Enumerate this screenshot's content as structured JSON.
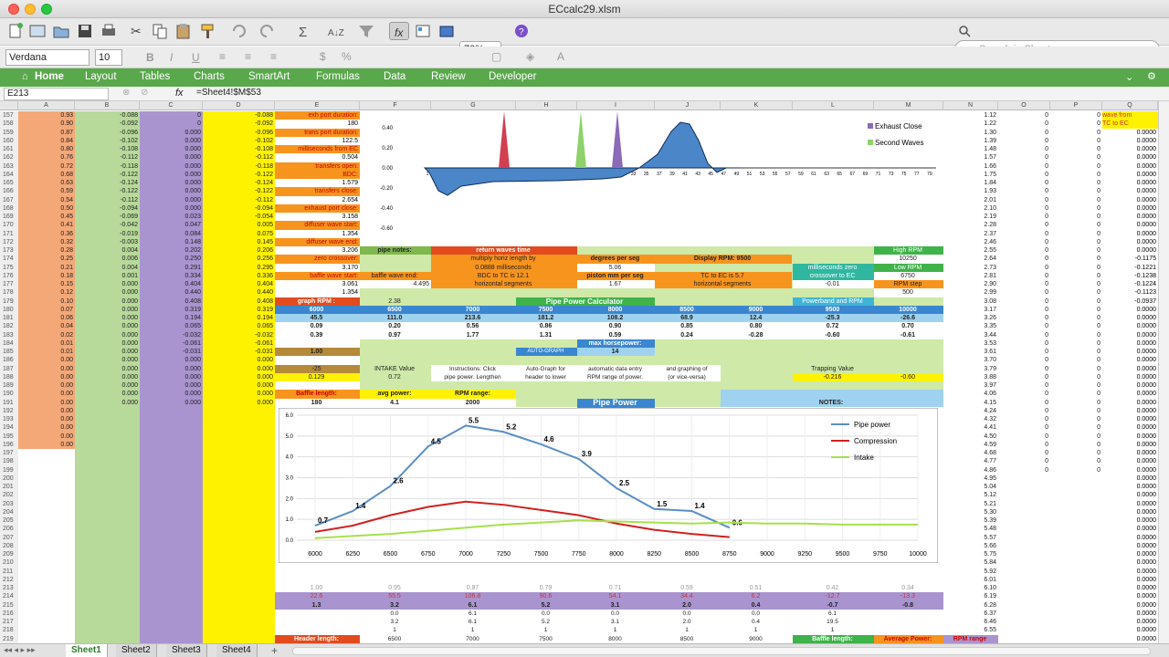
{
  "window": {
    "title": "ECcalc29.xlsm"
  },
  "toolbar": {
    "zoom": "70%",
    "search_placeholder": "Search in Sheet"
  },
  "fontbar": {
    "font_name": "Verdana",
    "font_size": "10"
  },
  "ribbon": {
    "tabs": [
      "Home",
      "Layout",
      "Tables",
      "Charts",
      "SmartArt",
      "Formulas",
      "Data",
      "Review",
      "Developer"
    ]
  },
  "formula_bar": {
    "cell_ref": "E213",
    "fx": "fx",
    "formula": "=Sheet4!$M$53"
  },
  "columns": [
    "A",
    "B",
    "C",
    "D",
    "E",
    "F",
    "G",
    "H",
    "I",
    "J",
    "K",
    "L",
    "M",
    "N",
    "O",
    "P",
    "Q"
  ],
  "rows": [
    "157",
    "158",
    "159",
    "160",
    "161",
    "162",
    "163",
    "164",
    "165",
    "166",
    "167",
    "168",
    "169",
    "170",
    "171",
    "172",
    "173",
    "174",
    "175",
    "176",
    "177",
    "178",
    "179",
    "180",
    "181",
    "182",
    "183",
    "184",
    "185",
    "186",
    "187",
    "188",
    "189",
    "190",
    "191",
    "192",
    "193",
    "194",
    "195",
    "196",
    "197",
    "198",
    "199",
    "200",
    "201",
    "202",
    "203",
    "204",
    "205",
    "206",
    "207",
    "208",
    "209",
    "210",
    "211",
    "212",
    "213",
    "214",
    "215",
    "216",
    "217",
    "218",
    "219",
    "220",
    "221"
  ],
  "col_a": [
    "0.93",
    "0.90",
    "0.87",
    "0.84",
    "0.80",
    "0.76",
    "0.72",
    "0.68",
    "0.63",
    "0.59",
    "0.54",
    "0.50",
    "0.45",
    "0.41",
    "0.36",
    "0.32",
    "0.28",
    "0.25",
    "0.21",
    "0.18",
    "0.15",
    "0.12",
    "0.10",
    "0.07",
    "0.06",
    "0.04",
    "0.02",
    "0.01",
    "0.01",
    "0.00",
    "0.00",
    "0.00",
    "0.00",
    "0.00",
    "0.00",
    "0.00",
    "0.00",
    "0.00",
    "0.00",
    "0.00"
  ],
  "col_b": [
    "-0.088",
    "-0.092",
    "-0.096",
    "-0.102",
    "-0.108",
    "-0.112",
    "-0.118",
    "-0.122",
    "-0.124",
    "-0.122",
    "-0.112",
    "-0.094",
    "-0.069",
    "-0.042",
    "-0.019",
    "-0.003",
    "0.004",
    "0.006",
    "0.004",
    "0.001",
    "0.000",
    "0.000",
    "0.000",
    "0.000",
    "0.000",
    "0.000",
    "0.000",
    "0.000",
    "0.000",
    "0.000",
    "0.000",
    "0.000",
    "0.000",
    "0.000",
    "0.000"
  ],
  "col_c": [
    "0",
    "0",
    "0.000",
    "0.000",
    "0.000",
    "0.000",
    "0.000",
    "0.000",
    "0.000",
    "0.000",
    "0.000",
    "0.000",
    "0.023",
    "0.047",
    "0.084",
    "0.148",
    "0.202",
    "0.250",
    "0.291",
    "0.334",
    "0.404",
    "0.440",
    "0.408",
    "0.319",
    "0.194",
    "0.065",
    "-0.032",
    "-0.061",
    "-0.031",
    "0.000",
    "0.000",
    "0.000",
    "0.000",
    "0.000",
    "0.000"
  ],
  "col_d": [
    "-0.088",
    "-0.092",
    "-0.096",
    "-0.102",
    "-0.108",
    "-0.112",
    "-0.118",
    "-0.122",
    "-0.124",
    "-0.122",
    "-0.112",
    "-0.094",
    "-0.054",
    "0.005",
    "0.075",
    "0.145",
    "0.206",
    "0.256",
    "0.295",
    "0.336",
    "0.404",
    "0.440",
    "0.408",
    "0.319",
    "0.194",
    "0.065",
    "-0.032",
    "-0.061",
    "-0.031",
    "0.000",
    "0.000",
    "0.000",
    "0.000",
    "0.000",
    "0.000"
  ],
  "col_e_labels": [
    "exh port duration:",
    "180",
    "trans port duration:",
    "122.5",
    "milliseconds from EC",
    "0.504",
    "transfers open:",
    "BDC:",
    "1.579",
    "transfers close:",
    "2.654",
    "exhaust port close:",
    "3.158",
    "diffuser wave start:",
    "1.354",
    "diffuser wave end:",
    "3.206",
    "zero crossover:",
    "3.170",
    "baffle wave start:",
    "3.061",
    "1.354"
  ],
  "col_n": [
    "1.12",
    "1.22",
    "1.30",
    "1.39",
    "1.48",
    "1.57",
    "1.66",
    "1.75",
    "1.84",
    "1.93",
    "2.01",
    "2.10",
    "2.19",
    "2.28",
    "2.37",
    "2.46",
    "2.55",
    "2.64",
    "2.73",
    "2.81",
    "2.90",
    "2.99",
    "3.08",
    "3.17",
    "3.26",
    "3.35",
    "3.44",
    "3.53",
    "3.61",
    "3.70",
    "3.79",
    "3.88",
    "3.97",
    "4.06",
    "4.15",
    "4.24",
    "4.32",
    "4.41",
    "4.50",
    "4.59",
    "4.68",
    "4.77",
    "4.86",
    "4.95",
    "5.04",
    "5.12",
    "5.21",
    "5.30",
    "5.39",
    "5.48",
    "5.57",
    "5.66",
    "5.75",
    "5.84",
    "5.92",
    "6.01",
    "6.10",
    "6.19",
    "6.28",
    "6.37",
    "6.46",
    "6.55",
    "6.63"
  ],
  "col_q": [
    "wave from",
    "TC to EC",
    "0.0000",
    "0.0000",
    "0.0000",
    "0.0000",
    "0.0000",
    "0.0000",
    "0.0000",
    "0.0000",
    "0.0000",
    "0.0000",
    "0.0000",
    "0.0000",
    "0.0000",
    "0.0000",
    "0.0000",
    "-0.1175",
    "-0.1221",
    "-0.1238",
    "-0.1224",
    "-0.1123",
    "-0.0937",
    "0.0000",
    "0.0000",
    "0.0000",
    "0.0000",
    "0.0000",
    "0.0000",
    "0.0000",
    "0.0000",
    "0.0000",
    "0.0000",
    "0.0000",
    "0.0000",
    "0.0000",
    "0.0000",
    "0.0000",
    "0.0000",
    "0.0000",
    "0.0000",
    "0.0000",
    "0.0000",
    "0.0000",
    "0.0000",
    "0.0000",
    "0.0000",
    "0.0000",
    "0.0000",
    "0.0000",
    "0.0000",
    "0.0000",
    "0.0000",
    "0.0000",
    "0.0000",
    "0.0000",
    "0.0000",
    "0.0000",
    "0.0000",
    "0.0000",
    "0.0000",
    "0.0000",
    "0.0000"
  ],
  "panel": {
    "pipe_notes": "pipe notes:",
    "return_waves_time": "return waves time",
    "multiply_horiz": "multiply horiz length by",
    "ms_value": "0.0888",
    "ms_label": "milliseconds",
    "bdc_to_tc": "BDC to TC is",
    "bdc_to_tc_val": "12.1",
    "horiz_segments": "horizontal segments",
    "degrees_per_seg": "degrees per seg",
    "degrees_per_seg_val": "5.06",
    "piston_mm": "piston mm per seg",
    "piston_mm_val": "1.67",
    "tc_to_ec": "TC to EC is",
    "tc_to_ec_val": "5.7",
    "display_rpm": "Display RPM:",
    "display_rpm_val": "9500",
    "high_rpm": "High RPM",
    "high_rpm_val": "10250",
    "low_rpm": "Low RPM",
    "low_rpm_val": "6750",
    "rpm_step": "RPM step",
    "rpm_step_val": "500",
    "ms_zero": "milliseconds zero",
    "crossover_ec": "crossover to EC",
    "crossover_val": "-0.01",
    "baffle_wave_end": "baffle wave end:",
    "baffle_wave_end_val": "4.495",
    "graph_rpm": "graph RPM :",
    "graph_rpm_val": "2.38",
    "pipe_power_calc": "Pipe Power    Calculator",
    "powerband_rpm": "Powerband and RPM",
    "rpm_headers": [
      "6000",
      "6500",
      "7000",
      "7500",
      "8000",
      "8500",
      "9000",
      "9500",
      "10000"
    ],
    "row181": [
      "45.5",
      "111.0",
      "213.6",
      "181.2",
      "108.2",
      "68.9",
      "12.4",
      "-25.3",
      "-26.6"
    ],
    "row182": [
      "0.09",
      "0.20",
      "0.56",
      "0.86",
      "0.90",
      "0.85",
      "0.80",
      "0.72",
      "0.70"
    ],
    "row183": [
      "0.39",
      "0.97",
      "1.77",
      "1.31",
      "0.59",
      "0.24",
      "-0.28",
      "-0.60",
      "-0.61"
    ],
    "val_100": "1.00",
    "auto_graph": "AUTO-GRAPH",
    "max_hp": "max horsepower:",
    "max_hp_val": "14",
    "intake_value": "INTAKE Value",
    "intake_val": "-25",
    "intake_val2": "0.129",
    "intake_val3": "0.72",
    "instructions1": "Instructions: Click",
    "instructions2": "pipe power. Lengthen",
    "autograph1": "Auto-Graph for",
    "autograph2": "header to lower",
    "auto_data1": "automatic data entry",
    "auto_data2": "RPM range of power.",
    "graphing1": "and graphing of",
    "graphing2": "(or vice-versa)",
    "trapping_value": "Trapping Value",
    "trapping_val": "-0.216",
    "trapping_val2": "-0.60",
    "baffle_length": "Baffle length:",
    "baffle_length_val": "180",
    "avg_power": "avg power:",
    "avg_power_val": "4.1",
    "rpm_range": "RPM range:",
    "rpm_range_val": "2000",
    "pipe_power_btn": "Pipe Power",
    "notes": "NOTES:",
    "row213": [
      "1.00",
      "0.95",
      "0.87",
      "0.79",
      "0.71",
      "0.59",
      "0.51",
      "0.42",
      "0.34"
    ],
    "row214": [
      "22.6",
      "55.5",
      "106.8",
      "90.6",
      "54.1",
      "34.4",
      "6.2",
      "-12.7",
      "-13.3"
    ],
    "row215": [
      "1.3",
      "3.2",
      "6.1",
      "5.2",
      "3.1",
      "2.0",
      "0.4",
      "-0.7",
      "-0.8"
    ],
    "row216": [
      "0.0",
      "6.1",
      "0.0",
      "0.0",
      "0.0",
      "0.0",
      "6.1"
    ],
    "row217": [
      "3.2",
      "6.1",
      "5.2",
      "3.1",
      "2.0",
      "0.4",
      "19.5"
    ],
    "row218": [
      "1",
      "1",
      "1",
      "1",
      "1",
      "1",
      "1"
    ],
    "header_length": "Header length:",
    "bottom_rpms": [
      "6500",
      "7000",
      "7500",
      "8000",
      "8500",
      "9000"
    ],
    "baffle_length_bottom": "Baffle length:",
    "average_power": "Average Power:",
    "rpm_range_bottom": "RPM range"
  },
  "chart_data": [
    {
      "type": "area",
      "series": [
        {
          "name": "Exhaust Close",
          "color": "#8b6ab8"
        },
        {
          "name": "Second Waves",
          "color": "#8fd16c"
        }
      ],
      "x": [
        "1",
        "3",
        "5",
        "7",
        "9",
        "11",
        "13",
        "15",
        "17",
        "19",
        "21",
        "23",
        "25",
        "27",
        "29",
        "31",
        "33",
        "35",
        "37",
        "39",
        "41",
        "43",
        "45",
        "47",
        "49",
        "51",
        "53",
        "55",
        "57",
        "59",
        "61",
        "63",
        "65",
        "67",
        "69",
        "71",
        "73",
        "75",
        "77",
        "79"
      ],
      "y_ticks": [
        "0.40",
        "0.20",
        "0.00",
        "-0.20",
        "-0.40",
        "-0.60"
      ],
      "ylim": [
        -0.6,
        0.4
      ]
    },
    {
      "type": "line",
      "categories": [
        "6000",
        "6250",
        "6500",
        "6750",
        "7000",
        "7250",
        "7500",
        "7750",
        "8000",
        "8250",
        "8500",
        "8750",
        "9000",
        "9250",
        "9500",
        "9750",
        "10000"
      ],
      "y_ticks": [
        "6.0",
        "5.0",
        "4.0",
        "3.0",
        "2.0",
        "1.0",
        "0.0"
      ],
      "ylim": [
        0,
        6
      ],
      "series": [
        {
          "name": "Pipe power",
          "color": "#5a8ec4",
          "values": [
            0.7,
            1.4,
            2.6,
            4.5,
            5.5,
            5.2,
            4.6,
            3.9,
            2.5,
            1.5,
            1.4,
            0.6,
            null,
            null,
            null,
            null,
            null
          ],
          "labels": [
            "0.7",
            "1.4",
            "2.6",
            "4.5",
            "5.5",
            "5.2",
            "4.6",
            "3.9",
            "2.5",
            "1.5",
            "1.4",
            "0.6"
          ]
        },
        {
          "name": "Compression",
          "color": "#d11f1f",
          "values": [
            0.4,
            0.7,
            1.2,
            1.6,
            1.85,
            1.7,
            1.45,
            1.2,
            0.8,
            0.5,
            0.3,
            0.15,
            null,
            null,
            null,
            null,
            null
          ]
        },
        {
          "name": "Intake",
          "color": "#a6e04c",
          "values": [
            0.1,
            0.2,
            0.3,
            0.45,
            0.6,
            0.75,
            0.85,
            0.95,
            0.9,
            0.85,
            0.8,
            0.85,
            0.8,
            0.8,
            0.75,
            0.75,
            0.75
          ]
        }
      ]
    }
  ],
  "sheet_tabs": [
    "Sheet1",
    "Sheet2",
    "Sheet3",
    "Sheet4"
  ]
}
